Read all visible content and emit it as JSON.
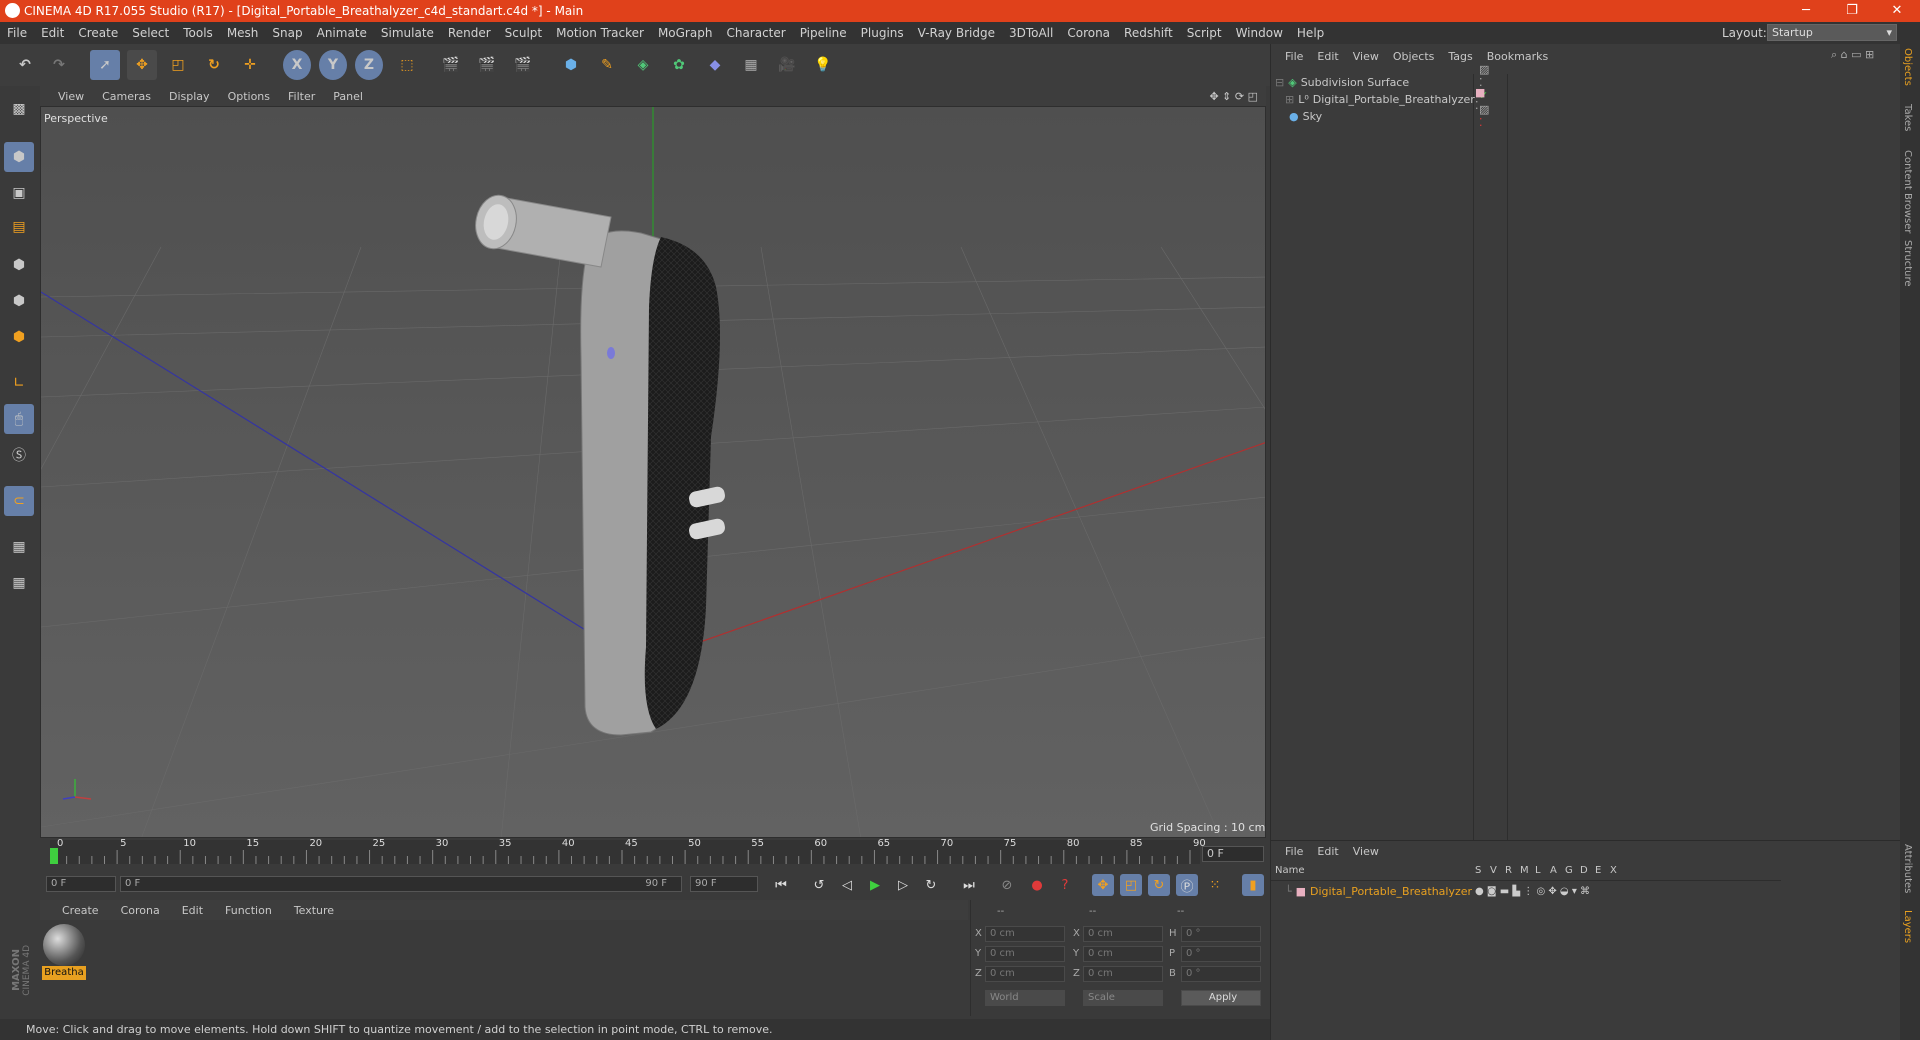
{
  "window": {
    "title": "CINEMA 4D R17.055 Studio (R17) - [Digital_Portable_Breathalyzer_c4d_standart.c4d *] - Main",
    "minimize": "─",
    "maximize": "❐",
    "close": "✕"
  },
  "menubar": [
    "File",
    "Edit",
    "Create",
    "Select",
    "Tools",
    "Mesh",
    "Snap",
    "Animate",
    "Simulate",
    "Render",
    "Sculpt",
    "Motion Tracker",
    "MoGraph",
    "Character",
    "Pipeline",
    "Plugins",
    "V-Ray Bridge",
    "3DToAll",
    "Corona",
    "Redshift",
    "Script",
    "Window",
    "Help"
  ],
  "layout": {
    "label": "Layout:",
    "value": "Startup"
  },
  "toolbar": {
    "x": "X",
    "y": "Y",
    "z": "Z"
  },
  "viewport": {
    "menu": [
      "View",
      "Cameras",
      "Display",
      "Options",
      "Filter",
      "Panel"
    ],
    "label": "Perspective",
    "grid_spacing": "Grid Spacing : 10 cm"
  },
  "timeline": {
    "ticks": [
      "0",
      "5",
      "10",
      "15",
      "20",
      "25",
      "30",
      "35",
      "40",
      "45",
      "50",
      "55",
      "60",
      "65",
      "70",
      "75",
      "80",
      "85",
      "90"
    ],
    "current": "0 F",
    "start": "0 F",
    "range_start": "0 F",
    "range_end": "90 F",
    "end": "90 F"
  },
  "material_panel": {
    "menu": [
      "Create",
      "Corona",
      "Edit",
      "Function",
      "Texture"
    ],
    "material_name": "Breatha"
  },
  "coordinates": {
    "header": [
      "--",
      "--",
      "--"
    ],
    "rows": [
      {
        "l1": "X",
        "v1": "0 cm",
        "l2": "X",
        "v2": "0 cm",
        "l3": "H",
        "v3": "0 °"
      },
      {
        "l1": "Y",
        "v1": "0 cm",
        "l2": "Y",
        "v2": "0 cm",
        "l3": "P",
        "v3": "0 °"
      },
      {
        "l1": "Z",
        "v1": "0 cm",
        "l2": "Z",
        "v2": "0 cm",
        "l3": "B",
        "v3": "0 °"
      }
    ],
    "space": "World",
    "mode": "Scale",
    "apply": "Apply"
  },
  "status": "Move: Click and drag to move elements. Hold down SHIFT to quantize movement / add to the selection in point mode, CTRL to remove.",
  "objects_panel": {
    "menu": [
      "File",
      "Edit",
      "View",
      "Objects",
      "Tags",
      "Bookmarks"
    ],
    "items": [
      {
        "name": "Subdivision Surface"
      },
      {
        "name": "Digital_Portable_Breathalyzer"
      },
      {
        "name": "Sky"
      }
    ]
  },
  "layers_panel": {
    "menu": [
      "File",
      "Edit",
      "View"
    ],
    "columns": [
      "Name",
      "S",
      "V",
      "R",
      "M",
      "L",
      "A",
      "G",
      "D",
      "E",
      "X"
    ],
    "layer": "Digital_Portable_Breathalyzer"
  },
  "right_tabs": [
    "Objects",
    "Takes",
    "Content Browser",
    "Structure",
    "Attributes",
    "Layers"
  ],
  "brand": {
    "maxon": "MAXON",
    "product": "CINEMA 4D"
  },
  "colors": {
    "titlebar": "#e0411b",
    "accent": "#667fa8",
    "layer_name": "#e8a020"
  }
}
